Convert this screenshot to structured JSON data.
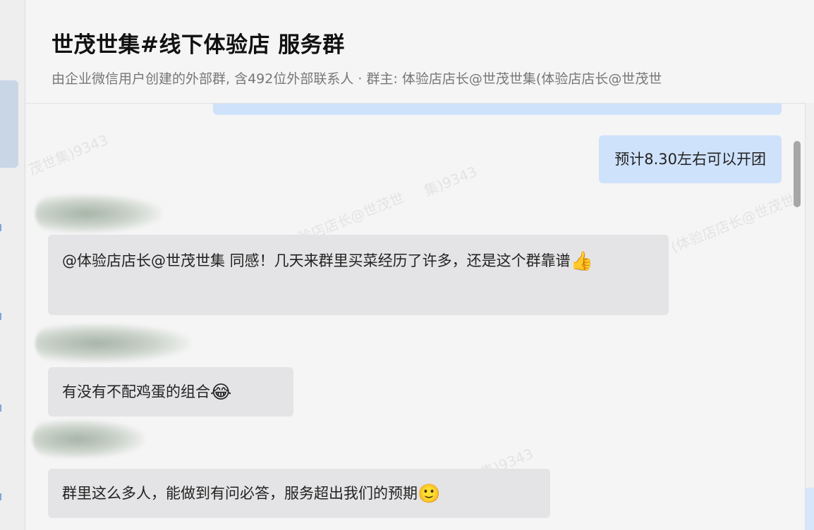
{
  "header": {
    "title": "世茂世集#线下体验店 服务群",
    "subtitle": "由企业微信用户创建的外部群, 含492位外部联系人 · 群主: 体验店店长@世茂世集(体验店店长@世茂世"
  },
  "watermark": {
    "text_1": "茂世集)9343",
    "text_2": "集)9343",
    "text_3": "茂世集(体验店店长@世茂世",
    "text_4": "(体验店店长@世茂世"
  },
  "messages": [
    {
      "side": "right",
      "text": "预计8.30左右可以开团"
    },
    {
      "side": "left",
      "sender": "",
      "text": "@体验店店长@世茂世集 同感！几天来群里买菜经历了许多，还是这个群靠谱",
      "emoji": "👍"
    },
    {
      "side": "left",
      "sender": "",
      "text": "有没有不配鸡蛋的组合",
      "emoji": "😂"
    },
    {
      "side": "left",
      "sender": "",
      "text": "群里这么多人，能做到有问必答，服务超出我们的预期",
      "emoji": "🙂"
    }
  ],
  "colors": {
    "self_bubble": "#cfe2fb",
    "other_bubble": "#e4e4e6",
    "background": "#f5f5f5"
  }
}
